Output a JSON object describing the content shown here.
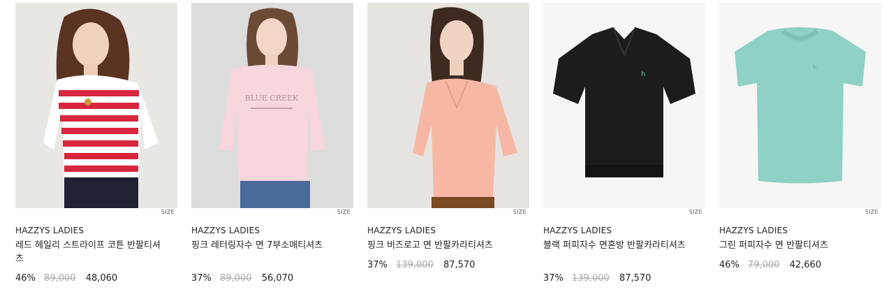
{
  "products": [
    {
      "size_label": "SIZE",
      "brand": "HAZZYS LADIES",
      "name": "레드 헤일리 스트라이프 코튼 반팔티셔츠",
      "discount": "46%",
      "original_price": "89,000",
      "final_price": "48,060"
    },
    {
      "size_label": "SIZE",
      "brand": "HAZZYS LADIES",
      "name": "핑크 레터링자수 면 7부소매티셔츠",
      "discount": "37%",
      "original_price": "89,000",
      "final_price": "56,070"
    },
    {
      "size_label": "SIZE",
      "brand": "HAZZYS LADIES",
      "name": "핑크 비즈로고 면 반팔카라티셔츠",
      "discount": "37%",
      "original_price": "139,000",
      "final_price": "87,570"
    },
    {
      "size_label": "SIZE",
      "brand": "HAZZYS LADIES",
      "name": "블랙 퍼피자수 면혼방 반팔카라티셔츠",
      "discount": "37%",
      "original_price": "139,000",
      "final_price": "87,570"
    },
    {
      "size_label": "SIZE",
      "brand": "HAZZYS LADIES",
      "name": "그린 퍼피자수 면 반팔티셔츠",
      "discount": "46%",
      "original_price": "79,000",
      "final_price": "42,660"
    }
  ],
  "colors": {
    "red_stripe": "#d7263d",
    "pink_tee": "#f7d6dc",
    "pink_polo": "#f6b8a4",
    "black_polo": "#1c1c1c",
    "mint_tee": "#8fd1c4"
  }
}
